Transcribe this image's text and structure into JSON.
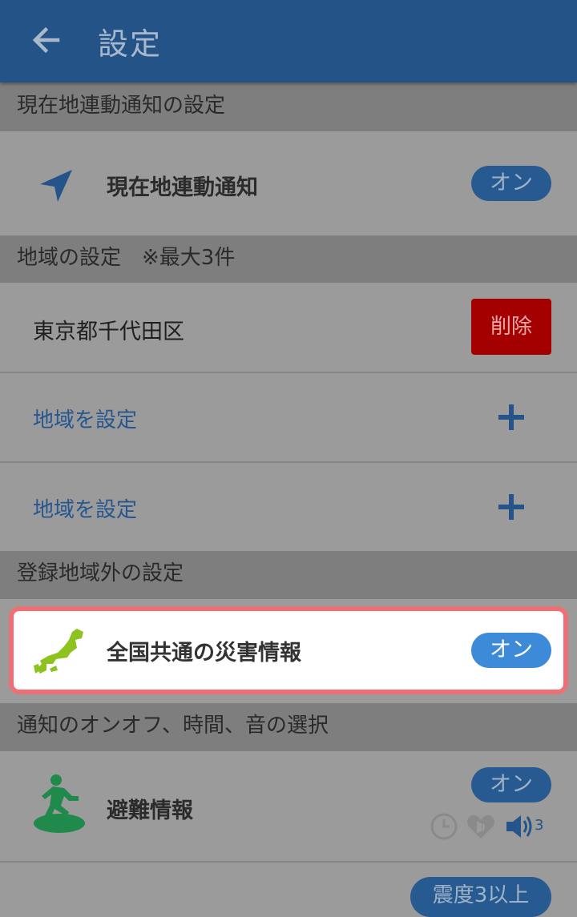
{
  "header": {
    "title": "設定",
    "back_icon": "arrow-left-icon"
  },
  "sections": {
    "location": {
      "header": "現在地連動通知の設定",
      "item_label": "現在地連動通知",
      "toggle": "オン",
      "icon": "navigation-arrow-icon"
    },
    "regions": {
      "header": "地域の設定　※最大3件",
      "items": [
        {
          "label": "東京都千代田区",
          "action": "削除"
        },
        {
          "label": "地域を設定"
        },
        {
          "label": "地域を設定"
        }
      ]
    },
    "outside": {
      "header": "登録地域外の設定",
      "item_label": "全国共通の災害情報",
      "toggle": "オン",
      "icon": "japan-map-icon"
    },
    "notifications": {
      "header": "通知のオンオフ、時間、音の選択",
      "item_label": "避難情報",
      "toggle": "オン",
      "icon": "evacuation-icon",
      "sound_level": "3",
      "next_badge": "震度3以上"
    }
  },
  "colors": {
    "appbar": "#245387",
    "toggle_on": "#3d8ad8",
    "delete": "#a50000",
    "highlight_border": "#f26d74",
    "evac_green": "#1f8a4c",
    "japan_green": "#8dc21f"
  }
}
